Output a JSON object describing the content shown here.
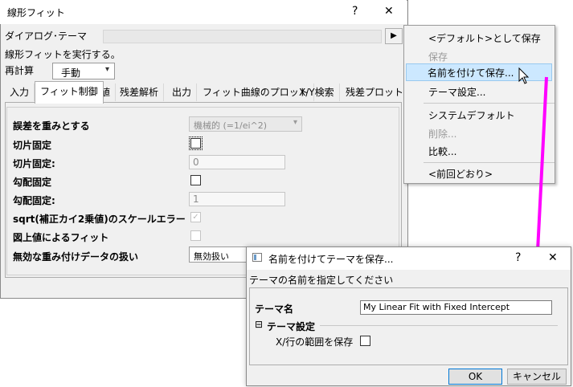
{
  "main_window": {
    "title": "線形フィット",
    "help": "?",
    "close": "✕",
    "dialog_theme_label": "ダイアログ･テーマ",
    "arrow": "▶",
    "description": "線形フィットを実行する。",
    "recalc_label": "再計算",
    "recalc_value": "手動",
    "tabs": [
      "入力",
      "フィット制御",
      "値",
      "残差解析",
      "出力",
      "フィット曲線のプロット",
      "X/Y検索",
      "残差プロット"
    ],
    "fields": {
      "weight_label": "誤差を重みとする",
      "weight_value": "機械的 (=1/ei^2)",
      "fix_intercept_label": "切片固定",
      "fix_intercept_at_label": "切片固定:",
      "fix_intercept_at_value": "0",
      "fix_slope_label": "勾配固定",
      "fix_slope_at_label": "勾配固定:",
      "fix_slope_at_value": "1",
      "scale_error_label": "sqrt(補正カイ2乗値)のスケールエラー",
      "apparent_fit_label": "図上値によるフィット",
      "invalid_weight_label": "無効な重み付けデータの扱い",
      "invalid_weight_value": "無効扱い"
    }
  },
  "context_menu": {
    "items": [
      {
        "label": "<デフォルト>として保存",
        "enabled": true
      },
      {
        "label": "保存",
        "enabled": false
      },
      {
        "label": "名前を付けて保存...",
        "enabled": true,
        "highlighted": true
      },
      {
        "label": "テーマ設定...",
        "enabled": true
      },
      {
        "label": "システムデフォルト",
        "enabled": true
      },
      {
        "label": "削除...",
        "enabled": false
      },
      {
        "label": "比較...",
        "enabled": true
      },
      {
        "label": "<前回どおり>",
        "enabled": true
      }
    ]
  },
  "save_dialog": {
    "title": "名前を付けてテーマを保存...",
    "help": "?",
    "close": "✕",
    "instruction": "テーマの名前を指定してください",
    "theme_name_label": "テーマ名",
    "theme_name_value": "My Linear Fit with Fixed Intercept",
    "theme_settings_label": "テーマ設定",
    "collapse_glyph": "⊟",
    "save_xy_range_label": "X/行の範囲を保存",
    "ok_label": "OK",
    "cancel_label": "キャンセル"
  },
  "colors": {
    "arrow": "#ff00ff",
    "highlight": "#cce8ff"
  }
}
